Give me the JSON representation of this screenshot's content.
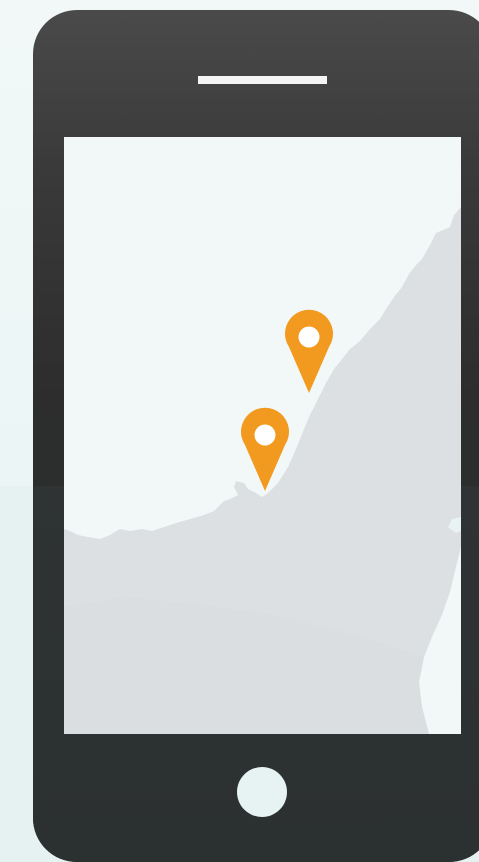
{
  "scene": {
    "device": "smartphone",
    "screen_content": "map",
    "icons": [
      "location-pin-icon",
      "location-pin-icon"
    ],
    "colors": {
      "background": "#eef6f6",
      "phone_body": "#2d2d2d",
      "screen": "#f2f8f8",
      "land": "#dcdfe1",
      "pin": "#f29a1f",
      "pin_center": "#ffffff",
      "speaker": "#f4f4f4",
      "home_button": "#e6f3f2"
    }
  }
}
